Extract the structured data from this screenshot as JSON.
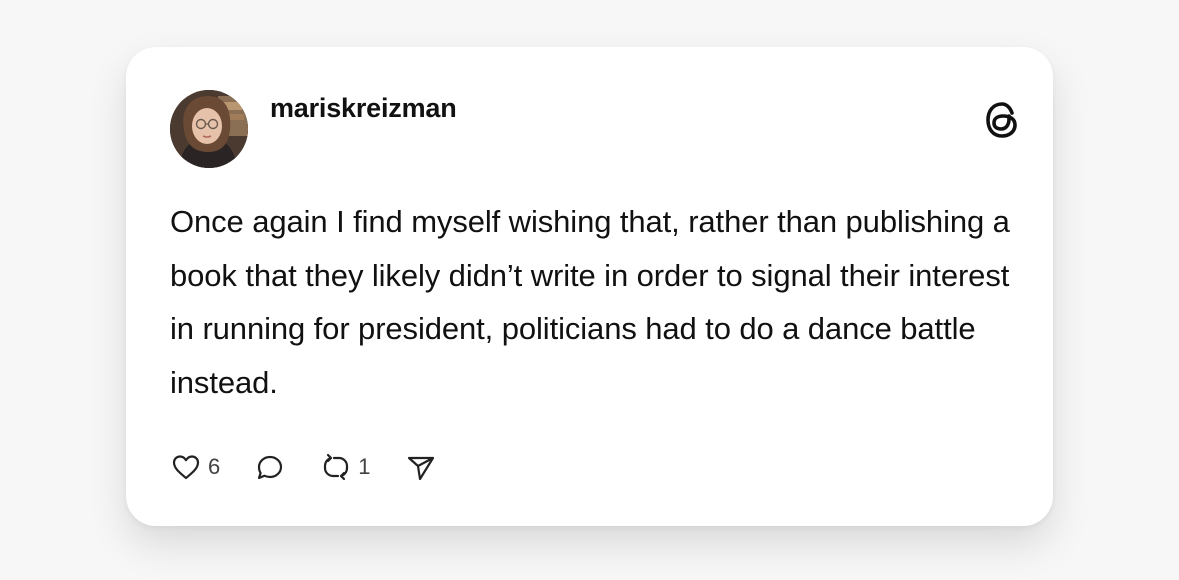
{
  "post": {
    "username": "mariskreizman",
    "text": "Once again I find myself wishing that, rather than publishing a book that they likely didn’t write in order to signal their interest in running for president, politicians had to do a dance battle instead.",
    "like_count": "6",
    "repost_count": "1"
  },
  "icons": {
    "brand": "threads-logo-icon",
    "like": "heart-icon",
    "reply": "speech-bubble-icon",
    "repost": "repost-arrows-icon",
    "share": "send-icon"
  },
  "colors": {
    "text": "#111111",
    "icon": "#222222",
    "count": "#424242",
    "card": "#ffffff",
    "background": "#f7f7f7"
  }
}
